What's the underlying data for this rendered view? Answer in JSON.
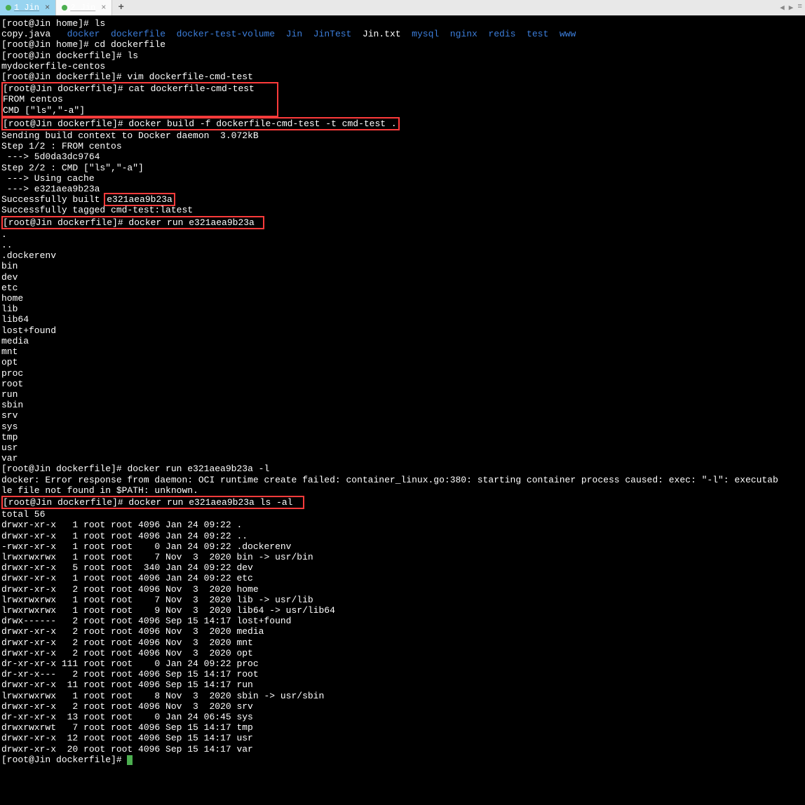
{
  "tabs": {
    "tab1": {
      "label": "1 Jin"
    },
    "tab2": {
      "label": "2 Jin"
    },
    "add": "+"
  },
  "tabbar_right": {
    "left": "◀",
    "right": "▶",
    "menu": "≡"
  },
  "t": {
    "p_home": "[root@Jin home]# ",
    "p_df": "[root@Jin dockerfile]# ",
    "cmd_ls": "ls",
    "ls_out": {
      "copy": "copy.java",
      "docker": "docker",
      "dockerfile": "dockerfile",
      "dtv": "docker-test-volume",
      "jin": "Jin",
      "jintest": "JinTest",
      "jintxt": "Jin.txt",
      "mysql": "mysql",
      "nginx": "nginx",
      "redis": "redis",
      "test": "test",
      "www": "www"
    },
    "cmd_cd": "cd dockerfile",
    "ls2_out": "mydockerfile-centos",
    "cmd_vim": "vim dockerfile-cmd-test",
    "box1_l1": "[root@Jin dockerfile]# cat dockerfile-cmd-test",
    "box1_l2": "FROM centos",
    "box1_l3": "CMD [\"ls\",\"-a\"]",
    "box2": "[root@Jin dockerfile]# docker build -f dockerfile-cmd-test -t cmd-test .",
    "build1": "Sending build context to Docker daemon  3.072kB",
    "build2": "Step 1/2 : FROM centos",
    "build3": " ---> 5d0da3dc9764",
    "build4": "Step 2/2 : CMD [\"ls\",\"-a\"]",
    "build5": " ---> Using cache",
    "build6": " ---> e321aea9b23a",
    "build7a": "Successfully built ",
    "build7b": "e321aea9b23a",
    "build8": "Successfully tagged cmd-test:latest",
    "box3": "[root@Jin dockerfile]# docker run e321aea9b23a",
    "run_out": [
      ".",
      "..",
      ".dockerenv",
      "bin",
      "dev",
      "etc",
      "home",
      "lib",
      "lib64",
      "lost+found",
      "media",
      "mnt",
      "opt",
      "proc",
      "root",
      "run",
      "sbin",
      "srv",
      "sys",
      "tmp",
      "usr",
      "var"
    ],
    "cmd_run_l": "docker run e321aea9b23a -l",
    "err": "docker: Error response from daemon: OCI runtime create failed: container_linux.go:380: starting container process caused: exec: \"-l\": executab\nle file not found in $PATH: unknown.",
    "box4": "[root@Jin dockerfile]# docker run e321aea9b23a ls -al",
    "lsal": [
      "total 56",
      "drwxr-xr-x   1 root root 4096 Jan 24 09:22 .",
      "drwxr-xr-x   1 root root 4096 Jan 24 09:22 ..",
      "-rwxr-xr-x   1 root root    0 Jan 24 09:22 .dockerenv",
      "lrwxrwxrwx   1 root root    7 Nov  3  2020 bin -> usr/bin",
      "drwxr-xr-x   5 root root  340 Jan 24 09:22 dev",
      "drwxr-xr-x   1 root root 4096 Jan 24 09:22 etc",
      "drwxr-xr-x   2 root root 4096 Nov  3  2020 home",
      "lrwxrwxrwx   1 root root    7 Nov  3  2020 lib -> usr/lib",
      "lrwxrwxrwx   1 root root    9 Nov  3  2020 lib64 -> usr/lib64",
      "drwx------   2 root root 4096 Sep 15 14:17 lost+found",
      "drwxr-xr-x   2 root root 4096 Nov  3  2020 media",
      "drwxr-xr-x   2 root root 4096 Nov  3  2020 mnt",
      "drwxr-xr-x   2 root root 4096 Nov  3  2020 opt",
      "dr-xr-xr-x 111 root root    0 Jan 24 09:22 proc",
      "dr-xr-x---   2 root root 4096 Sep 15 14:17 root",
      "drwxr-xr-x  11 root root 4096 Sep 15 14:17 run",
      "lrwxrwxrwx   1 root root    8 Nov  3  2020 sbin -> usr/sbin",
      "drwxr-xr-x   2 root root 4096 Nov  3  2020 srv",
      "dr-xr-xr-x  13 root root    0 Jan 24 06:45 sys",
      "drwxrwxrwt   7 root root 4096 Sep 15 14:17 tmp",
      "drwxr-xr-x  12 root root 4096 Sep 15 14:17 usr",
      "drwxr-xr-x  20 root root 4096 Sep 15 14:17 var"
    ]
  }
}
